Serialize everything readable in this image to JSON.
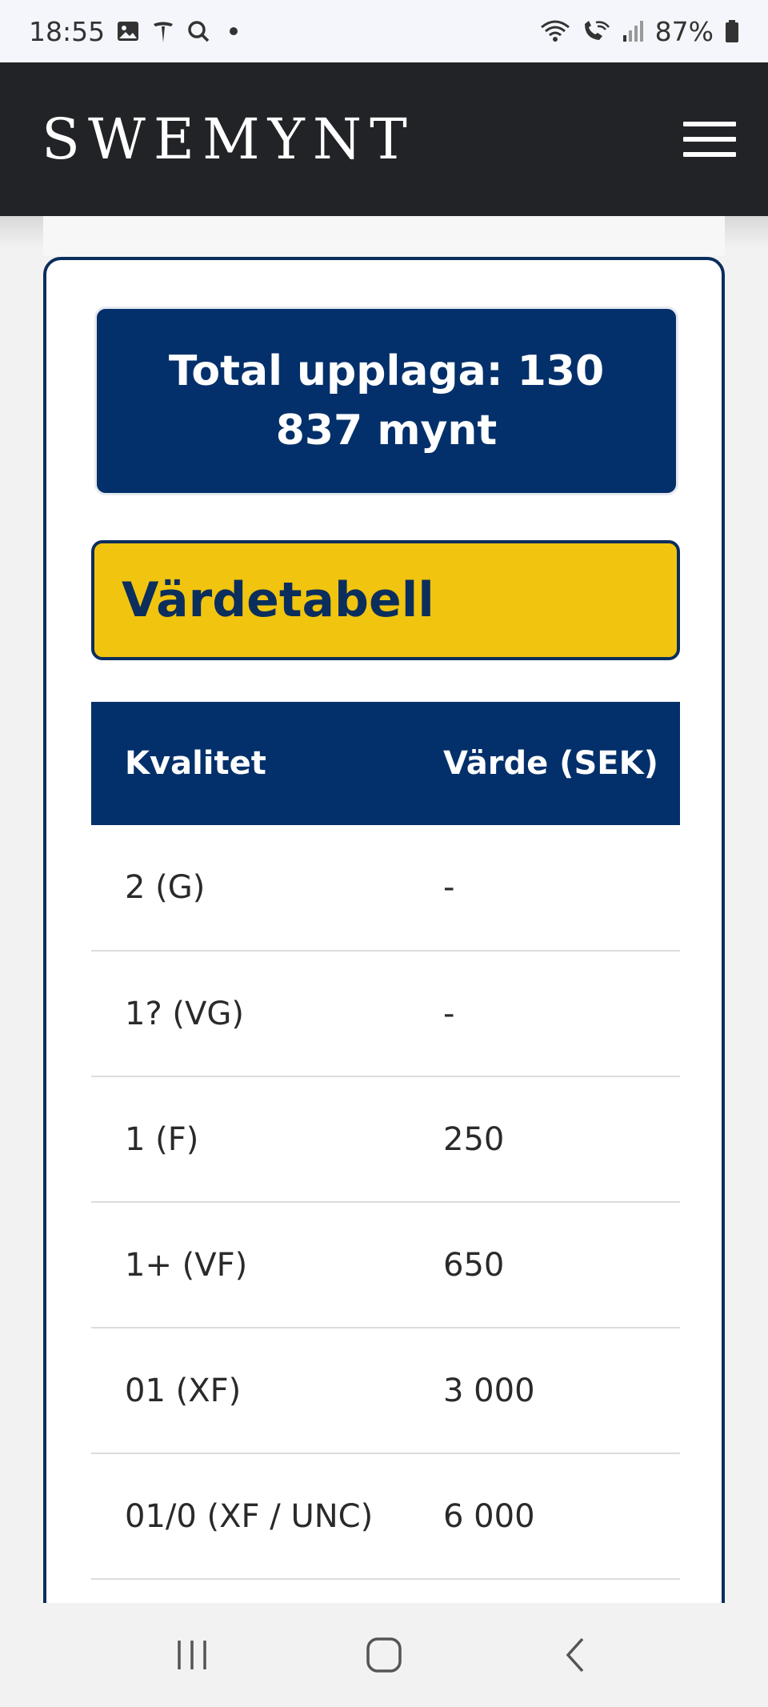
{
  "status_bar": {
    "time": "18:55",
    "left_icons": [
      "gallery-icon",
      "tesla-icon",
      "search-icon",
      "dot-icon"
    ],
    "right_icons": [
      "wifi-icon",
      "wifi-call-icon",
      "signal-icon",
      "battery-icon"
    ],
    "battery": "87%"
  },
  "header": {
    "logo": "SWEMYNT",
    "menu_icon": "hamburger-menu-icon"
  },
  "card": {
    "total_text": "Total upplaga: 130 837 mynt",
    "section_title": "Värdetabell",
    "table": {
      "headers": [
        "Kvalitet",
        "Värde (SEK)"
      ],
      "rows": [
        {
          "quality": "2 (G)",
          "value": "-"
        },
        {
          "quality": "1? (VG)",
          "value": "-"
        },
        {
          "quality": "1 (F)",
          "value": "250"
        },
        {
          "quality": "1+ (VF)",
          "value": "650"
        },
        {
          "quality": "01 (XF)",
          "value": "3 000"
        },
        {
          "quality": "01/0 (XF / UNC)",
          "value": "6 000"
        }
      ]
    }
  },
  "nav_bar": {
    "buttons": [
      "recent-apps-icon",
      "home-icon",
      "back-icon"
    ]
  },
  "colors": {
    "header_bg": "#222326",
    "navy": "#03306a",
    "yellow": "#f1c40f"
  }
}
